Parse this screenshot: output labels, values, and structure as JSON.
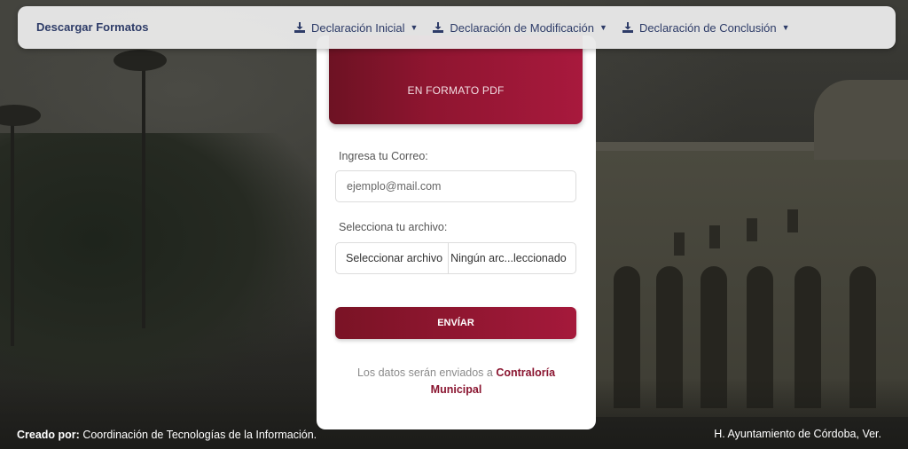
{
  "navbar": {
    "brand": "Descargar Formatos",
    "menus": [
      {
        "label": "Declaración Inicial",
        "icon": "download-icon"
      },
      {
        "label": "Declaración de Modificación",
        "icon": "download-icon"
      },
      {
        "label": "Declaración de Conclusión",
        "icon": "download-icon"
      }
    ]
  },
  "card": {
    "hero_text": "EN FORMATO PDF",
    "email_label": "Ingresa tu Correo:",
    "email_placeholder": "ejemplo@mail.com",
    "file_label": "Selecciona tu archivo:",
    "file_button": "Seleccionar archivo",
    "file_status": "Ningún arc...leccionado",
    "send_button": "ENVÍAR",
    "note_prefix": "Los datos serán enviados a",
    "note_strong": "Contraloría Municipal"
  },
  "footer": {
    "created_label": "Creado por:",
    "created_value": "Coordinación de Tecnologías de la Información.",
    "right_text": "H. Ayuntamiento de Córdoba, Ver."
  },
  "colors": {
    "accent": "#a5193b",
    "accent_dark": "#7a1325",
    "nav_text": "#2e3c68"
  }
}
